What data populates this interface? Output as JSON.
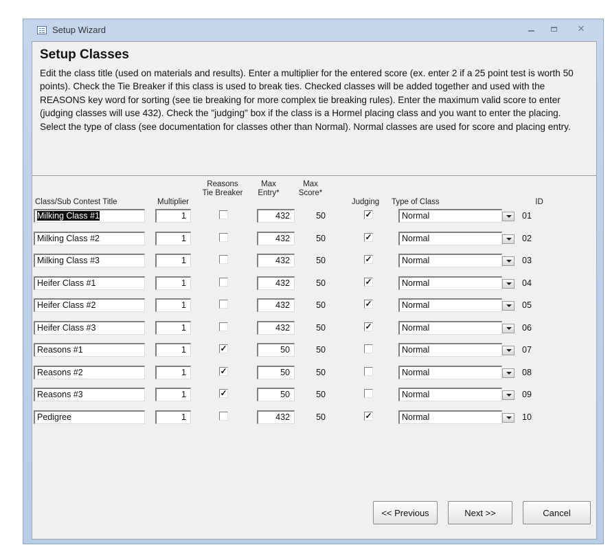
{
  "window": {
    "title": "Setup Wizard"
  },
  "page": {
    "heading": "Setup Classes",
    "description": "Edit the class title (used on materials and results).  Enter a multiplier for the entered score (ex. enter 2 if a 25 point test is worth 50 points).  Check the Tie Breaker if this class is used to break ties.  Checked classes will be added together and used with the REASONS key word for sorting (see tie breaking for more complex tie breaking rules).  Enter the maximum valid score to enter (judging classes will use 432).  Check the \"judging\" box if the class is a Hormel placing class and you want to enter the placing.  Select the type of class (see documentation for classes other than Normal).  Normal classes are used for score and placing entry."
  },
  "headers": {
    "title": "Class/Sub Contest Title",
    "multiplier": "Multiplier",
    "tiebreaker_1": "Reasons",
    "tiebreaker_2": "Tie Breaker",
    "maxentry_1": "Max",
    "maxentry_2": "Entry*",
    "maxscore_1": "Max",
    "maxscore_2": "Score*",
    "judging": "Judging",
    "type": "Type of Class",
    "id": "ID"
  },
  "rows": [
    {
      "title": "Milking Class #1",
      "multiplier": "1",
      "tiebreaker": false,
      "max_entry": "432",
      "max_score": "50",
      "judging": true,
      "type": "Normal",
      "id": "01"
    },
    {
      "title": "Milking Class #2",
      "multiplier": "1",
      "tiebreaker": false,
      "max_entry": "432",
      "max_score": "50",
      "judging": true,
      "type": "Normal",
      "id": "02"
    },
    {
      "title": "Milking Class #3",
      "multiplier": "1",
      "tiebreaker": false,
      "max_entry": "432",
      "max_score": "50",
      "judging": true,
      "type": "Normal",
      "id": "03"
    },
    {
      "title": "Heifer Class #1",
      "multiplier": "1",
      "tiebreaker": false,
      "max_entry": "432",
      "max_score": "50",
      "judging": true,
      "type": "Normal",
      "id": "04"
    },
    {
      "title": "Heifer Class #2",
      "multiplier": "1",
      "tiebreaker": false,
      "max_entry": "432",
      "max_score": "50",
      "judging": true,
      "type": "Normal",
      "id": "05"
    },
    {
      "title": "Heifer Class #3",
      "multiplier": "1",
      "tiebreaker": false,
      "max_entry": "432",
      "max_score": "50",
      "judging": true,
      "type": "Normal",
      "id": "06"
    },
    {
      "title": "Reasons #1",
      "multiplier": "1",
      "tiebreaker": true,
      "max_entry": "50",
      "max_score": "50",
      "judging": false,
      "type": "Normal",
      "id": "07"
    },
    {
      "title": "Reasons #2",
      "multiplier": "1",
      "tiebreaker": true,
      "max_entry": "50",
      "max_score": "50",
      "judging": false,
      "type": "Normal",
      "id": "08"
    },
    {
      "title": "Reasons #3",
      "multiplier": "1",
      "tiebreaker": true,
      "max_entry": "50",
      "max_score": "50",
      "judging": false,
      "type": "Normal",
      "id": "09"
    },
    {
      "title": "Pedigree",
      "multiplier": "1",
      "tiebreaker": false,
      "max_entry": "432",
      "max_score": "50",
      "judging": true,
      "type": "Normal",
      "id": "10"
    }
  ],
  "buttons": {
    "previous": "<< Previous",
    "next": "Next >>",
    "cancel": "Cancel"
  },
  "check_mark": "✓"
}
